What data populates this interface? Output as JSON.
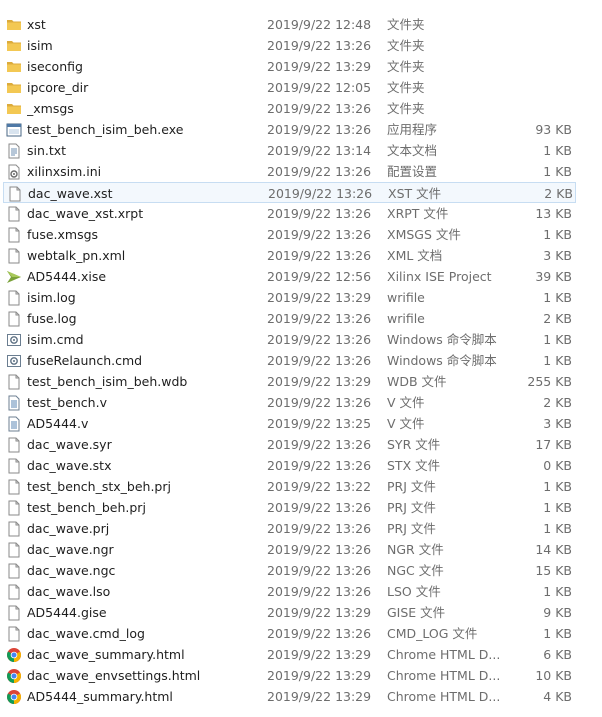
{
  "files": [
    {
      "name": "xst",
      "date": "2019/9/22 12:48",
      "type": "文件夹",
      "size": "",
      "icon": "folder-icon"
    },
    {
      "name": "isim",
      "date": "2019/9/22 13:26",
      "type": "文件夹",
      "size": "",
      "icon": "folder-icon"
    },
    {
      "name": "iseconfig",
      "date": "2019/9/22 13:29",
      "type": "文件夹",
      "size": "",
      "icon": "folder-icon"
    },
    {
      "name": "ipcore_dir",
      "date": "2019/9/22 12:05",
      "type": "文件夹",
      "size": "",
      "icon": "folder-icon"
    },
    {
      "name": "_xmsgs",
      "date": "2019/9/22 13:26",
      "type": "文件夹",
      "size": "",
      "icon": "folder-icon"
    },
    {
      "name": "test_bench_isim_beh.exe",
      "date": "2019/9/22 13:26",
      "type": "应用程序",
      "size": "93 KB",
      "icon": "exe-icon"
    },
    {
      "name": "sin.txt",
      "date": "2019/9/22 13:14",
      "type": "文本文档",
      "size": "1 KB",
      "icon": "text-file-icon"
    },
    {
      "name": "xilinxsim.ini",
      "date": "2019/9/22 13:26",
      "type": "配置设置",
      "size": "1 KB",
      "icon": "config-file-icon"
    },
    {
      "name": "dac_wave.xst",
      "date": "2019/9/22 13:26",
      "type": "XST 文件",
      "size": "2 KB",
      "icon": "blank-file-icon",
      "selected": true
    },
    {
      "name": "dac_wave_xst.xrpt",
      "date": "2019/9/22 13:26",
      "type": "XRPT 文件",
      "size": "13 KB",
      "icon": "blank-file-icon"
    },
    {
      "name": "fuse.xmsgs",
      "date": "2019/9/22 13:26",
      "type": "XMSGS 文件",
      "size": "1 KB",
      "icon": "blank-file-icon"
    },
    {
      "name": "webtalk_pn.xml",
      "date": "2019/9/22 13:26",
      "type": "XML 文档",
      "size": "3 KB",
      "icon": "blank-file-icon"
    },
    {
      "name": "AD5444.xise",
      "date": "2019/9/22 12:56",
      "type": "Xilinx ISE Project",
      "size": "39 KB",
      "icon": "xilinx-project-icon"
    },
    {
      "name": "isim.log",
      "date": "2019/9/22 13:29",
      "type": "wrifile",
      "size": "1 KB",
      "icon": "blank-file-icon"
    },
    {
      "name": "fuse.log",
      "date": "2019/9/22 13:26",
      "type": "wrifile",
      "size": "2 KB",
      "icon": "blank-file-icon"
    },
    {
      "name": "isim.cmd",
      "date": "2019/9/22 13:26",
      "type": "Windows 命令脚本",
      "size": "1 KB",
      "icon": "cmd-script-icon"
    },
    {
      "name": "fuseRelaunch.cmd",
      "date": "2019/9/22 13:26",
      "type": "Windows 命令脚本",
      "size": "1 KB",
      "icon": "cmd-script-icon"
    },
    {
      "name": "test_bench_isim_beh.wdb",
      "date": "2019/9/22 13:29",
      "type": "WDB 文件",
      "size": "255 KB",
      "icon": "blank-file-icon"
    },
    {
      "name": "test_bench.v",
      "date": "2019/9/22 13:26",
      "type": "V 文件",
      "size": "2 KB",
      "icon": "verilog-file-icon"
    },
    {
      "name": "AD5444.v",
      "date": "2019/9/22 13:25",
      "type": "V 文件",
      "size": "3 KB",
      "icon": "verilog-file-icon"
    },
    {
      "name": "dac_wave.syr",
      "date": "2019/9/22 13:26",
      "type": "SYR 文件",
      "size": "17 KB",
      "icon": "blank-file-icon"
    },
    {
      "name": "dac_wave.stx",
      "date": "2019/9/22 13:26",
      "type": "STX 文件",
      "size": "0 KB",
      "icon": "blank-file-icon"
    },
    {
      "name": "test_bench_stx_beh.prj",
      "date": "2019/9/22 13:22",
      "type": "PRJ 文件",
      "size": "1 KB",
      "icon": "blank-file-icon"
    },
    {
      "name": "test_bench_beh.prj",
      "date": "2019/9/22 13:26",
      "type": "PRJ 文件",
      "size": "1 KB",
      "icon": "blank-file-icon"
    },
    {
      "name": "dac_wave.prj",
      "date": "2019/9/22 13:26",
      "type": "PRJ 文件",
      "size": "1 KB",
      "icon": "blank-file-icon"
    },
    {
      "name": "dac_wave.ngr",
      "date": "2019/9/22 13:26",
      "type": "NGR 文件",
      "size": "14 KB",
      "icon": "blank-file-icon"
    },
    {
      "name": "dac_wave.ngc",
      "date": "2019/9/22 13:26",
      "type": "NGC 文件",
      "size": "15 KB",
      "icon": "blank-file-icon"
    },
    {
      "name": "dac_wave.lso",
      "date": "2019/9/22 13:26",
      "type": "LSO 文件",
      "size": "1 KB",
      "icon": "blank-file-icon"
    },
    {
      "name": "AD5444.gise",
      "date": "2019/9/22 13:29",
      "type": "GISE 文件",
      "size": "9 KB",
      "icon": "blank-file-icon"
    },
    {
      "name": "dac_wave.cmd_log",
      "date": "2019/9/22 13:26",
      "type": "CMD_LOG 文件",
      "size": "1 KB",
      "icon": "blank-file-icon"
    },
    {
      "name": "dac_wave_summary.html",
      "date": "2019/9/22 13:29",
      "type": "Chrome HTML D...",
      "size": "6 KB",
      "icon": "chrome-html-icon"
    },
    {
      "name": "dac_wave_envsettings.html",
      "date": "2019/9/22 13:29",
      "type": "Chrome HTML D...",
      "size": "10 KB",
      "icon": "chrome-html-icon"
    },
    {
      "name": "AD5444_summary.html",
      "date": "2019/9/22 13:29",
      "type": "Chrome HTML D...",
      "size": "4 KB",
      "icon": "chrome-html-icon"
    }
  ]
}
